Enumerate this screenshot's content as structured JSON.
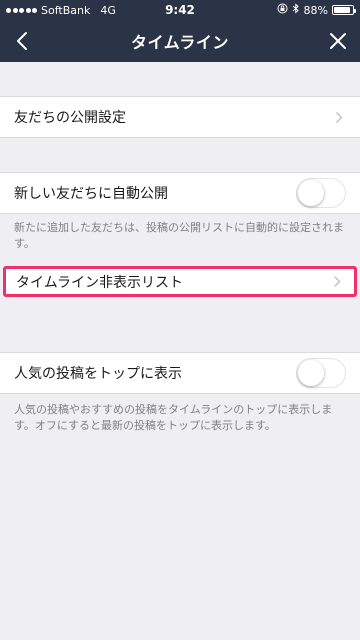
{
  "status_bar": {
    "carrier": "SoftBank",
    "network": "4G",
    "time": "9:42",
    "battery": "88%",
    "battery_level": 0.88
  },
  "nav": {
    "title": "タイムライン"
  },
  "settings": {
    "public_settings_label": "友だちの公開設定",
    "auto_publish_label": "新しい友だちに自動公開",
    "auto_publish_on": false,
    "auto_publish_desc": "新たに追加した友だちは、投稿の公開リストに自動的に設定されます。",
    "hidden_list_label": "タイムライン非表示リスト",
    "popular_top_label": "人気の投稿をトップに表示",
    "popular_top_on": false,
    "popular_top_desc": "人気の投稿やおすすめの投稿をタイムラインのトップに表示します。オフにすると最新の投稿をトップに表示します。"
  },
  "colors": {
    "header_bg": "#2b3446",
    "page_bg": "#eeeef3",
    "highlight": "#f0306a"
  }
}
